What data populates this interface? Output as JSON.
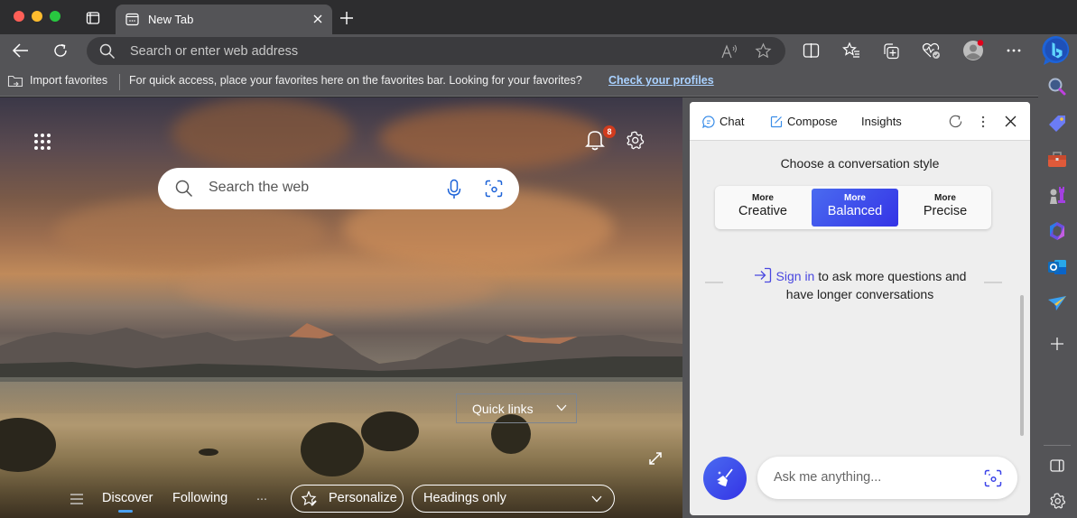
{
  "window": {
    "traffic_lights": {
      "close": "#ff5f57",
      "minimize": "#febc2e",
      "maximize": "#28c840"
    }
  },
  "tabs": [
    {
      "title": "New Tab",
      "icon": "new-tab-page-icon",
      "active": true
    }
  ],
  "toolbar": {
    "address_placeholder": "Search or enter web address",
    "icons": [
      "back-icon",
      "refresh-icon",
      "read-aloud-icon",
      "favorite-star-icon",
      "split-screen-icon",
      "favorites-icon",
      "collections-icon",
      "browser-essentials-icon",
      "profile-icon",
      "more-icon",
      "copilot-icon"
    ]
  },
  "favorites_bar": {
    "import_label": "Import favorites",
    "message": "For quick access, place your favorites here on the favorites bar. Looking for your favorites?",
    "link_label": "Check your profiles"
  },
  "new_tab_page": {
    "search_placeholder": "Search the web",
    "notification_count": "8",
    "quick_links_label": "Quick links",
    "feed": {
      "tabs": [
        "Discover",
        "Following"
      ],
      "active_tab": "Discover",
      "more_label": "...",
      "personalize_label": "Personalize",
      "layout_select": "Headings only"
    }
  },
  "copilot": {
    "tabs": [
      "Chat",
      "Compose",
      "Insights"
    ],
    "style_title": "Choose a conversation style",
    "styles": [
      {
        "prefix": "More",
        "label": "Creative",
        "active": false
      },
      {
        "prefix": "More",
        "label": "Balanced",
        "active": true
      },
      {
        "prefix": "More",
        "label": "Precise",
        "active": false
      }
    ],
    "signin_link": "Sign in",
    "signin_line1": " to ask more questions and",
    "signin_line2": "have longer conversations",
    "ask_placeholder": "Ask me anything...",
    "accent": "#3d45e8"
  },
  "sidebar": {
    "apps": [
      "search-icon",
      "shopping-tag-icon",
      "tools-icon",
      "games-icon",
      "microsoft-365-icon",
      "outlook-icon",
      "drop-icon"
    ],
    "add_label": "+"
  }
}
